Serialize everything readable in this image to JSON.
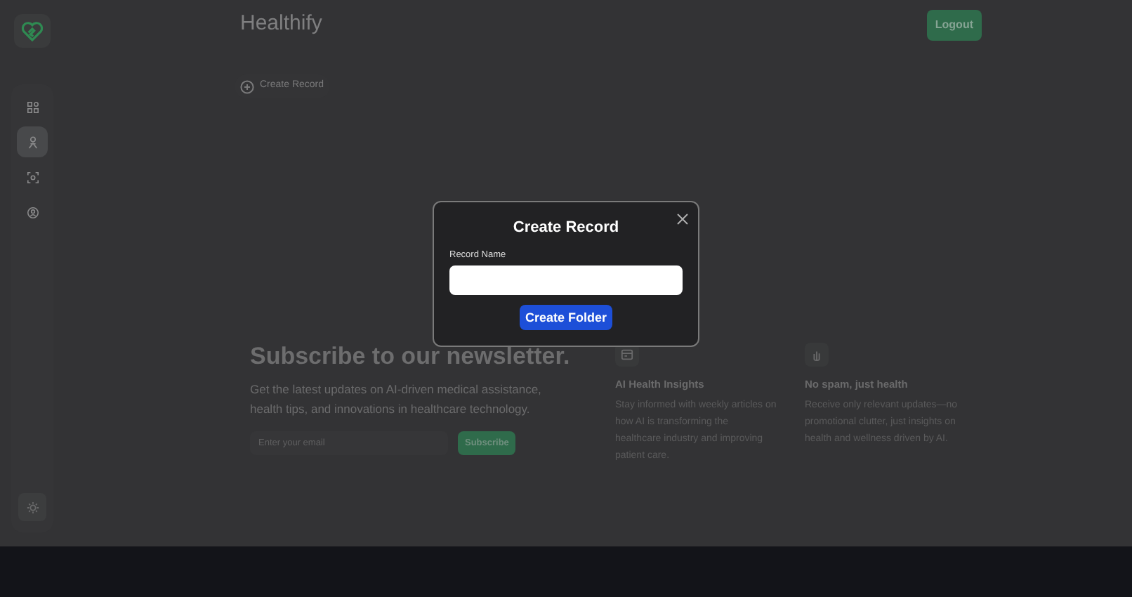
{
  "header": {
    "title": "Healthify",
    "logout": "Logout"
  },
  "sidebar": {
    "items": [
      {
        "kind": "grid",
        "selected": false
      },
      {
        "kind": "person",
        "selected": true
      },
      {
        "kind": "scan",
        "selected": false
      },
      {
        "kind": "profile",
        "selected": false
      }
    ]
  },
  "create_record_button": "Create Record",
  "newsletter": {
    "heading": "Subscribe to our newsletter.",
    "text": "Get the latest updates on AI-driven medical assistance, health tips, and innovations in healthcare technology.",
    "email": {
      "placeholder": "Enter your email"
    },
    "subscribe": "Subscribe",
    "features": [
      {
        "title": "AI Health Insights",
        "text": "Stay informed with weekly articles on how AI is transforming the healthcare industry and improving patient care."
      },
      {
        "title": "No spam, just health",
        "text": "Receive only relevant updates—no promotional clutter, just insights on health and wellness driven by AI."
      }
    ]
  },
  "modal": {
    "title": "Create Record",
    "field_label": "Record Name",
    "button": "Create Folder"
  }
}
